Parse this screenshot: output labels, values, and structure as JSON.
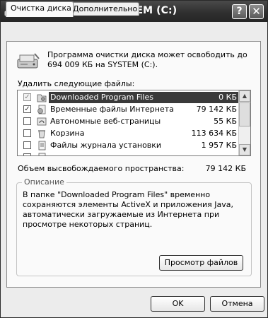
{
  "window": {
    "title": "Очистка диска SYSTEM (C:)",
    "help_label": "?",
    "close_label": "✕"
  },
  "tabs": [
    {
      "label": "Очистка диска",
      "active": true
    },
    {
      "label": "Дополнительно",
      "active": false
    }
  ],
  "intro_text": "Программа очистки диска может освободить до 694 009 КБ на SYSTEM (C:).",
  "list_label": "Удалить следующие файлы:",
  "files": [
    {
      "name": "Downloaded Program Files",
      "size": "0 КБ",
      "checked": true,
      "disabled": true,
      "selected": true,
      "icon": "folder-icon"
    },
    {
      "name": "Временные файлы Интернета",
      "size": "79 142 КБ",
      "checked": true,
      "disabled": false,
      "selected": false,
      "icon": "internet-files-icon"
    },
    {
      "name": "Автономные веб-страницы",
      "size": "55 КБ",
      "checked": false,
      "disabled": false,
      "selected": false,
      "icon": "offline-pages-icon"
    },
    {
      "name": "Корзина",
      "size": "113 634 КБ",
      "checked": false,
      "disabled": false,
      "selected": false,
      "icon": "recycle-bin-icon"
    },
    {
      "name": "Файлы журнала установки",
      "size": "1 957 КБ",
      "checked": false,
      "disabled": false,
      "selected": false,
      "icon": "log-file-icon"
    },
    {
      "name": "",
      "size": "",
      "checked": false,
      "disabled": false,
      "selected": false,
      "icon": "file-icon"
    }
  ],
  "space_label": "Объем высвобождаемого пространства:",
  "space_value": "79 142 КБ",
  "description": {
    "group_title": "Описание",
    "text": "В папке \"Downloaded Program Files\" временно сохраняются элементы ActiveX и приложения Java, автоматически загружаемые из Интернета при просмотре некоторых страниц.",
    "view_files_label": "Просмотр файлов"
  },
  "buttons": {
    "ok": "OK",
    "cancel": "Отмена"
  }
}
